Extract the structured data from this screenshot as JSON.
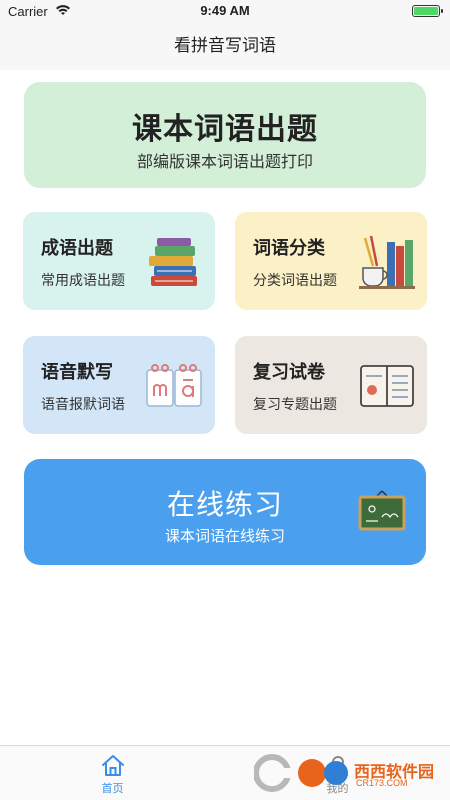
{
  "status_bar": {
    "carrier": "Carrier",
    "time": "9:49 AM",
    "battery_level": 1.0
  },
  "nav": {
    "title": "看拼音写词语"
  },
  "hero": {
    "title": "课本词语出题",
    "subtitle": "部编版课本词语出题打印",
    "color": "#d3efd8"
  },
  "tiles": [
    {
      "title": "成语出题",
      "subtitle": "常用成语出题",
      "icon": "books-stack-icon",
      "color": "#d8f2ee"
    },
    {
      "title": "词语分类",
      "subtitle": "分类词语出题",
      "icon": "books-coffee-icon",
      "color": "#fbf0c6"
    },
    {
      "title": "语音默写",
      "subtitle": "语音报默词语",
      "icon": "pinyin-cards-icon",
      "color": "#d2e6f7"
    },
    {
      "title": "复习试卷",
      "subtitle": "复习专题出题",
      "icon": "notebook-icon",
      "color": "#ece7e0"
    }
  ],
  "practice": {
    "title": "在线练习",
    "subtitle": "课本词语在线练习",
    "icon": "chalkboard-icon",
    "color": "#4aa0ef"
  },
  "tab_bar": {
    "tabs": [
      {
        "label": "首页",
        "icon": "home-icon",
        "active": true
      },
      {
        "label": "我的",
        "icon": "user-icon",
        "active": false
      }
    ]
  },
  "watermark": {
    "text": "西西软件园",
    "sub": "CR173.COM"
  }
}
